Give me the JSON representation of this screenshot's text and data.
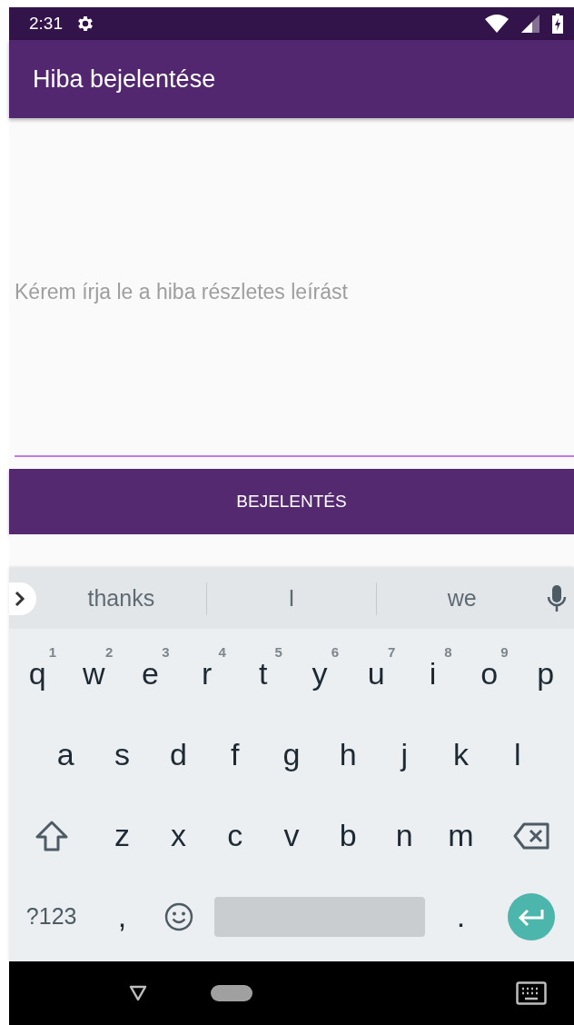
{
  "status_bar": {
    "time": "2:31"
  },
  "app_bar": {
    "title": "Hiba bejelentése"
  },
  "form": {
    "description_field": {
      "placeholder": "Kérem írja le a hiba részletes leírást",
      "focused": true
    },
    "submit_button": {
      "label": "BEJELENTÉS"
    }
  },
  "keyboard": {
    "suggestions": [
      "thanks",
      "I",
      "we"
    ],
    "rows": [
      {
        "keys": [
          {
            "kind": "char",
            "label": "q",
            "hint": "1"
          },
          {
            "kind": "char",
            "label": "w",
            "hint": "2"
          },
          {
            "kind": "char",
            "label": "e",
            "hint": "3"
          },
          {
            "kind": "char",
            "label": "r",
            "hint": "4"
          },
          {
            "kind": "char",
            "label": "t",
            "hint": "5"
          },
          {
            "kind": "char",
            "label": "y",
            "hint": "6"
          },
          {
            "kind": "char",
            "label": "u",
            "hint": "7"
          },
          {
            "kind": "char",
            "label": "i",
            "hint": "8"
          },
          {
            "kind": "char",
            "label": "o",
            "hint": "9"
          },
          {
            "kind": "char",
            "label": "p"
          }
        ]
      },
      {
        "keys": [
          {
            "kind": "char",
            "label": "a"
          },
          {
            "kind": "char",
            "label": "s"
          },
          {
            "kind": "char",
            "label": "d"
          },
          {
            "kind": "char",
            "label": "f"
          },
          {
            "kind": "char",
            "label": "g"
          },
          {
            "kind": "char",
            "label": "h"
          },
          {
            "kind": "char",
            "label": "j"
          },
          {
            "kind": "char",
            "label": "k"
          },
          {
            "kind": "char",
            "label": "l"
          }
        ]
      },
      {
        "keys": [
          {
            "kind": "shift"
          },
          {
            "kind": "char",
            "label": "z"
          },
          {
            "kind": "char",
            "label": "x"
          },
          {
            "kind": "char",
            "label": "c"
          },
          {
            "kind": "char",
            "label": "v"
          },
          {
            "kind": "char",
            "label": "b"
          },
          {
            "kind": "char",
            "label": "n"
          },
          {
            "kind": "char",
            "label": "m"
          },
          {
            "kind": "backspace"
          }
        ]
      },
      {
        "keys": [
          {
            "kind": "mode",
            "label": "?123"
          },
          {
            "kind": "char",
            "label": ","
          },
          {
            "kind": "emoji"
          },
          {
            "kind": "space"
          },
          {
            "kind": "char",
            "label": "."
          },
          {
            "kind": "enter"
          }
        ]
      }
    ]
  }
}
